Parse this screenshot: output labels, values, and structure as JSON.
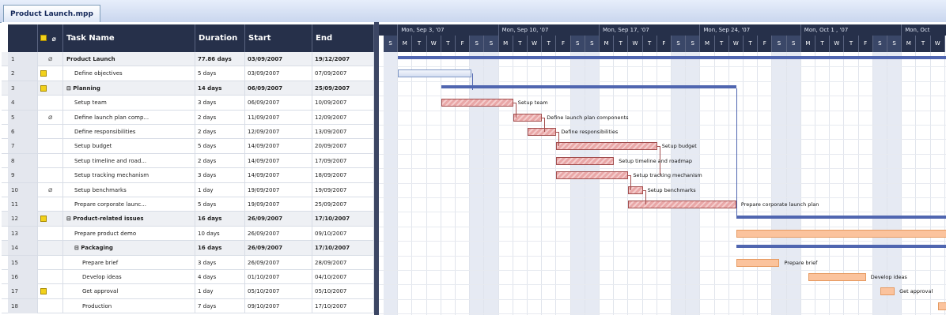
{
  "tab": {
    "title": "Product Launch.mpp"
  },
  "columns": {
    "id": "",
    "info": "",
    "task_name": "Task Name",
    "duration": "Duration",
    "start": "Start",
    "end": "End"
  },
  "timescale": {
    "weeks": [
      "Mon, Sep 3, '07",
      "Mon, Sep 10, '07",
      "Mon, Sep 17, '07",
      "Mon, Sep 24, '07",
      "Mon, Oct 1 , '07",
      "Mon, Oct"
    ],
    "days": [
      "S",
      "M",
      "T",
      "W",
      "T",
      "F",
      "S",
      "S",
      "M",
      "T",
      "W",
      "T",
      "F",
      "S",
      "S",
      "M",
      "T",
      "W",
      "T",
      "F",
      "S",
      "S",
      "M",
      "T",
      "W",
      "T",
      "F",
      "S",
      "S",
      "M",
      "T",
      "W",
      "T",
      "F",
      "S",
      "S",
      "M",
      "T",
      "W"
    ]
  },
  "tasks": [
    {
      "id": "1",
      "name": "Product Launch",
      "duration": "77.86 days",
      "start": "03/09/2007",
      "end": "19/12/2007",
      "bold": true,
      "indent": 0,
      "note": false,
      "clip": true
    },
    {
      "id": "2",
      "name": "Define objectives",
      "duration": "5 days",
      "start": "03/09/2007",
      "end": "07/09/2007",
      "bold": false,
      "indent": 1,
      "note": true,
      "clip": false
    },
    {
      "id": "3",
      "name": "⊟ Planning",
      "duration": "14 days",
      "start": "06/09/2007",
      "end": "25/09/2007",
      "bold": true,
      "indent": 0,
      "note": true,
      "clip": false
    },
    {
      "id": "4",
      "name": "Setup team",
      "duration": "3 days",
      "start": "06/09/2007",
      "end": "10/09/2007",
      "bold": false,
      "indent": 1,
      "note": false,
      "clip": false
    },
    {
      "id": "5",
      "name": "Define launch plan comp...",
      "duration": "2 days",
      "start": "11/09/2007",
      "end": "12/09/2007",
      "bold": false,
      "indent": 1,
      "note": false,
      "clip": true
    },
    {
      "id": "6",
      "name": "Define responsibilities",
      "duration": "2 days",
      "start": "12/09/2007",
      "end": "13/09/2007",
      "bold": false,
      "indent": 1,
      "note": false,
      "clip": false
    },
    {
      "id": "7",
      "name": "Setup budget",
      "duration": "5 days",
      "start": "14/09/2007",
      "end": "20/09/2007",
      "bold": false,
      "indent": 1,
      "note": false,
      "clip": false
    },
    {
      "id": "8",
      "name": "Setup timeline and road...",
      "duration": "2 days",
      "start": "14/09/2007",
      "end": "17/09/2007",
      "bold": false,
      "indent": 1,
      "note": false,
      "clip": false
    },
    {
      "id": "9",
      "name": "Setup tracking mechanism",
      "duration": "3 days",
      "start": "14/09/2007",
      "end": "18/09/2007",
      "bold": false,
      "indent": 1,
      "note": false,
      "clip": false
    },
    {
      "id": "10",
      "name": "Setup benchmarks",
      "duration": "1 day",
      "start": "19/09/2007",
      "end": "19/09/2007",
      "bold": false,
      "indent": 1,
      "note": false,
      "clip": true
    },
    {
      "id": "11",
      "name": "Prepare corporate launc...",
      "duration": "5 days",
      "start": "19/09/2007",
      "end": "25/09/2007",
      "bold": false,
      "indent": 1,
      "note": false,
      "clip": false
    },
    {
      "id": "12",
      "name": "⊟ Product-related issues",
      "duration": "16 days",
      "start": "26/09/2007",
      "end": "17/10/2007",
      "bold": true,
      "indent": 0,
      "note": true,
      "clip": false
    },
    {
      "id": "13",
      "name": "Prepare product demo",
      "duration": "10 days",
      "start": "26/09/2007",
      "end": "09/10/2007",
      "bold": false,
      "indent": 1,
      "note": false,
      "clip": false
    },
    {
      "id": "14",
      "name": "⊟ Packaging",
      "duration": "16 days",
      "start": "26/09/2007",
      "end": "17/10/2007",
      "bold": true,
      "indent": 1,
      "note": false,
      "clip": false
    },
    {
      "id": "15",
      "name": "Prepare brief",
      "duration": "3 days",
      "start": "26/09/2007",
      "end": "28/09/2007",
      "bold": false,
      "indent": 2,
      "note": false,
      "clip": false
    },
    {
      "id": "16",
      "name": "Develop ideas",
      "duration": "4 days",
      "start": "01/10/2007",
      "end": "04/10/2007",
      "bold": false,
      "indent": 2,
      "note": false,
      "clip": false
    },
    {
      "id": "17",
      "name": "Get approval",
      "duration": "1 day",
      "start": "05/10/2007",
      "end": "05/10/2007",
      "bold": false,
      "indent": 2,
      "note": true,
      "clip": false
    },
    {
      "id": "18",
      "name": "Production",
      "duration": "7 days",
      "start": "09/10/2007",
      "end": "17/10/2007",
      "bold": false,
      "indent": 2,
      "note": false,
      "clip": false
    }
  ],
  "bar_labels": {
    "r4": "Setup team",
    "r5": "Define launch plan components",
    "r6": "Define responsibilities",
    "r7": "Setup budget",
    "r8": "Setup timeline and roadmap",
    "r9": "Setup tracking mechanism",
    "r10": "Setup benchmarks",
    "r11": "Prepare corporate launch plan",
    "r15": "Prepare brief",
    "r16": "Develop ideas",
    "r17": "Get approval"
  },
  "colors": {
    "header": "#26304a",
    "task_bar": "#e9a7a7",
    "orange_bar": "#fbc39d",
    "summary": "#5066b0"
  }
}
